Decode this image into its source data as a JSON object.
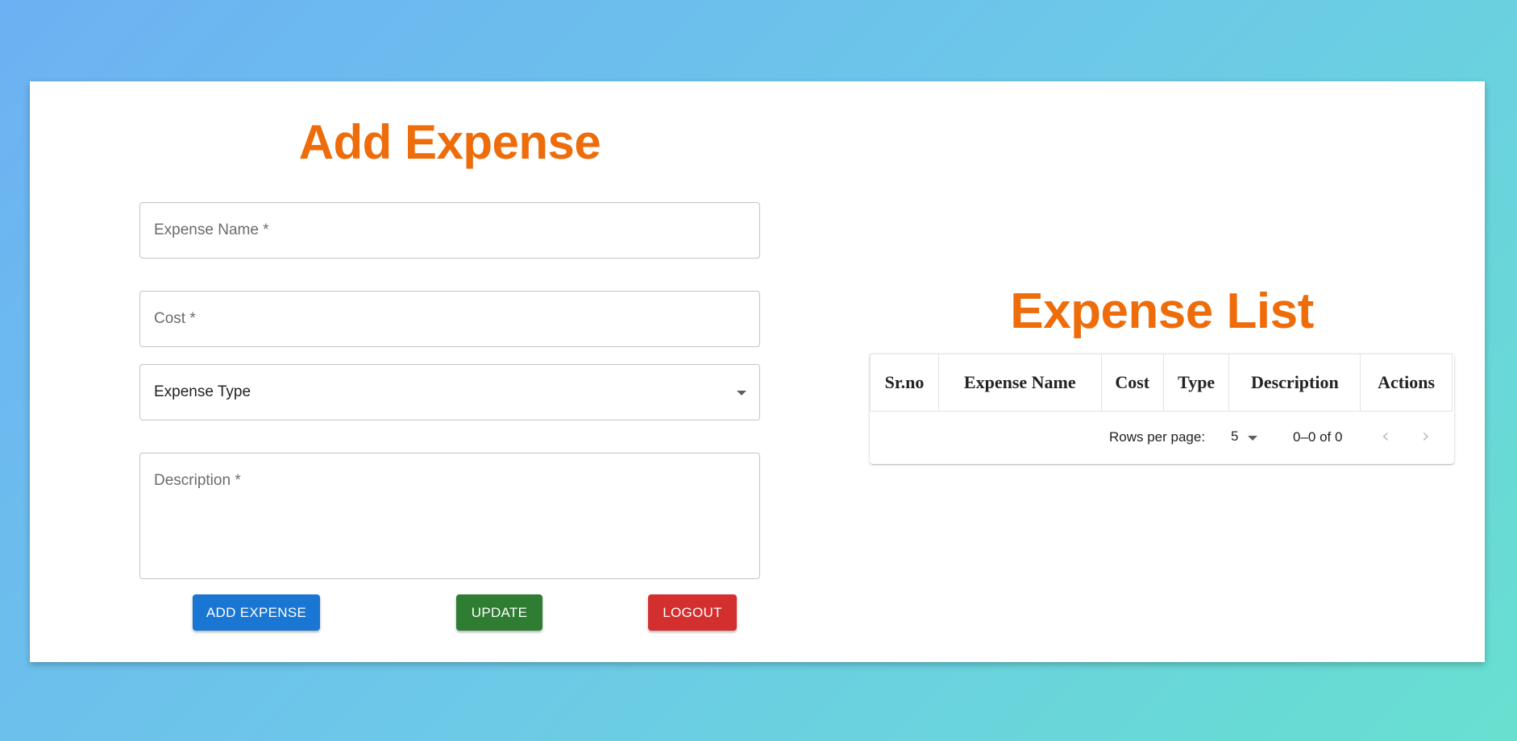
{
  "add_form": {
    "title": "Add Expense",
    "expense_name_placeholder": "Expense Name *",
    "cost_placeholder": "Cost *",
    "expense_type_label": "Expense Type",
    "description_placeholder": "Description *",
    "add_button": "ADD EXPENSE",
    "update_button": "UPDATE",
    "logout_button": "LOGOUT"
  },
  "expense_list": {
    "title": "Expense List",
    "columns": [
      "Sr.no",
      "Expense Name",
      "Cost",
      "Type",
      "Description",
      "Actions"
    ],
    "rows": [],
    "pagination": {
      "rows_per_page_label": "Rows per page:",
      "rows_per_page": "5",
      "range": "0–0 of 0",
      "prev_icon": "chevron-left-icon",
      "next_icon": "chevron-right-icon"
    }
  },
  "colors": {
    "heading": "#ee6c0a",
    "add_button": "#1976d2",
    "update_button": "#2e7d32",
    "logout_button": "#d32f2f"
  }
}
